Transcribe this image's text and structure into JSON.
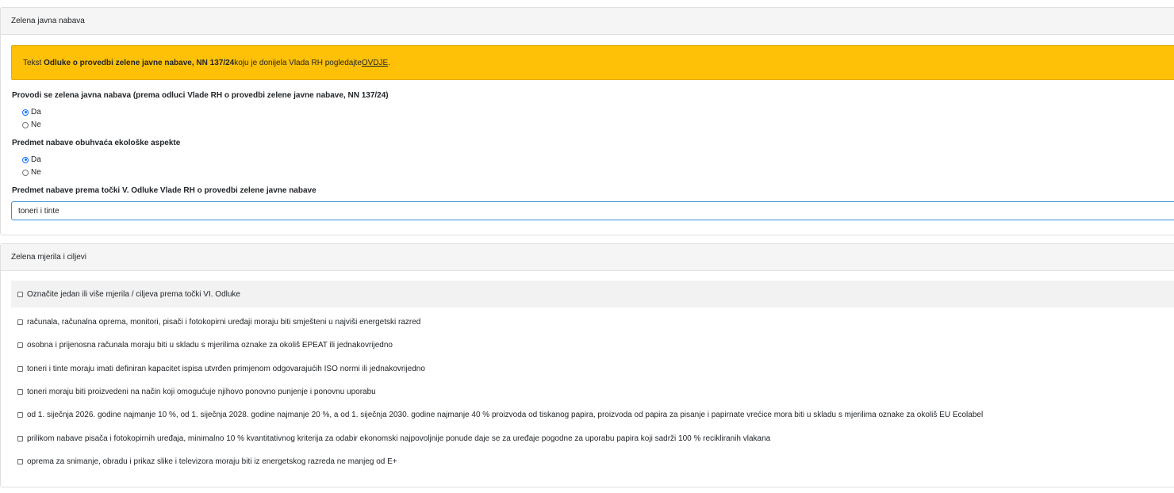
{
  "section1": {
    "header": "Zelena javna nabava",
    "alert": {
      "prefix": "Tekst ",
      "bold": "Odluke o provedbi zelene javne nabave, NN 137/24",
      "middle": " koju je donijela Vlada RH pogledajte ",
      "link": "OVDJE",
      "suffix": "."
    },
    "q1": {
      "label": "Provodi se zelena javna nabava (prema odluci Vlade RH o provedbi zelene javne nabave, NN 137/24)",
      "options": [
        "Da",
        "Ne"
      ],
      "selected": "Da"
    },
    "q2": {
      "label": "Predmet nabave obuhvaća ekološke aspekte",
      "options": [
        "Da",
        "Ne"
      ],
      "selected": "Da"
    },
    "q3": {
      "label": "Predmet nabave prema točki V. Odluke Vlade RH o provedbi zelene javne nabave",
      "value": "toneri i tinte"
    }
  },
  "section2": {
    "header": "Zelena mjerila i ciljevi",
    "select_all": "Označite jedan ili više mjerila / ciljeva prema točki VI. Odluke",
    "items": [
      "računala, računalna oprema, monitori, pisači i fotokopirni uređaji moraju biti smješteni u najviši energetski razred",
      "osobna i prijenosna računala moraju biti u skladu s mjerilima oznake za okoliš EPEAT ili jednakovrijedno",
      "toneri i tinte moraju imati definiran kapacitet ispisa utvrđen primjenom odgovarajućih ISO normi ili jednakovrijedno",
      "toneri moraju biti proizvedeni na način koji omogućuje njihovo ponovno punjenje i ponovnu uporabu",
      "od 1. siječnja 2026. godine najmanje 10 %, od 1. siječnja 2028. godine najmanje 20 %, a od 1. siječnja 2030. godine najmanje 40 % proizvoda od tiskanog papira, proizvoda od papira za pisanje i papirnate vrećice mora biti u skladu s mjerilima oznake za okoliš EU Ecolabel",
      "prilikom nabave pisača i fotokopirnih uređaja, minimalno 10 % kvantitativnog kriterija za odabir ekonomski najpovoljnije ponude daje se za uređaje pogodne za uporabu papira koji sadrži 100 % recikliranih vlakana",
      "oprema za snimanje, obradu i prikaz slike i televizora moraju biti iz energetskog razreda ne manjeg od E+"
    ]
  },
  "colors": {
    "alert_bg": "#ffc107",
    "radio_checked": "#0d6efd",
    "input_border": "#3b8fd9",
    "header_bg": "#f5f5f5"
  }
}
